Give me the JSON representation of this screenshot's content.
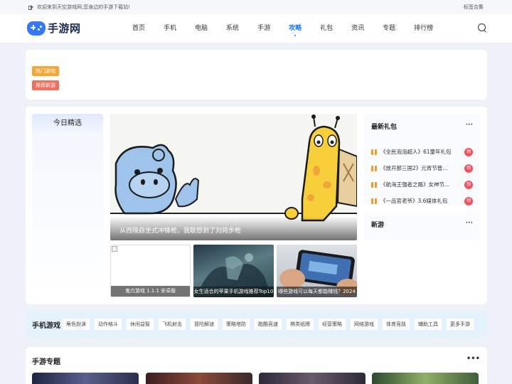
{
  "topbar": {
    "welcome": "欢迎来到天空游戏网,您身边的手游下载站!",
    "tag_collection": "标签合集"
  },
  "header": {
    "logo_text": "手游网",
    "nav": [
      {
        "label": "首页",
        "active": false
      },
      {
        "label": "手机",
        "active": false
      },
      {
        "label": "电脑",
        "active": false
      },
      {
        "label": "系统",
        "active": false
      },
      {
        "label": "手游",
        "active": false
      },
      {
        "label": "攻略",
        "active": true
      },
      {
        "label": "礼包",
        "active": false
      },
      {
        "label": "资讯",
        "active": false
      },
      {
        "label": "专题",
        "active": false
      },
      {
        "label": "排行榜",
        "active": false
      }
    ]
  },
  "tags": {
    "hot": "热门游戏",
    "recommended": "推荐新游"
  },
  "today": {
    "title": "今日精选"
  },
  "hero": {
    "caption": "从西陵启坐式冲锋枪，我联想到了刘将步枪"
  },
  "thumbs": [
    {
      "caption": "鬼刃游戏 1.1.1 安卓版"
    },
    {
      "caption": "女生适合的苹果手机游戏推荐Top10"
    },
    {
      "caption": "哪些游戏可以每天都能赚钱？2024"
    }
  ],
  "gifts": {
    "title": "最新礼包",
    "more": "···",
    "badge": "领",
    "items": [
      {
        "name": "《全民泡泡超人》61童年礼包"
      },
      {
        "name": "《放开那三国2》元宵节普..."
      },
      {
        "name": "《航海王强者之路》女神节..."
      },
      {
        "name": "《一品官老爷》3.6媒体礼包"
      }
    ]
  },
  "news": {
    "title": "新游",
    "more": "···"
  },
  "categories": {
    "title": "手机游戏",
    "items": [
      "角色扮演",
      "动作格斗",
      "休闲益智",
      "飞机射击",
      "冒险解谜",
      "策略塔防",
      "跑酷竞速",
      "棋类纸牌",
      "经营策略",
      "网络游戏",
      "体育竞技",
      "辅助工具",
      "更多手游"
    ]
  },
  "topics": {
    "title": "手游专题",
    "more": "•••"
  },
  "colors": {
    "accent": "#1677ff",
    "tag_hot": "#f7a536",
    "tag_rec": "#f2705e",
    "badge": "#f0525f"
  }
}
